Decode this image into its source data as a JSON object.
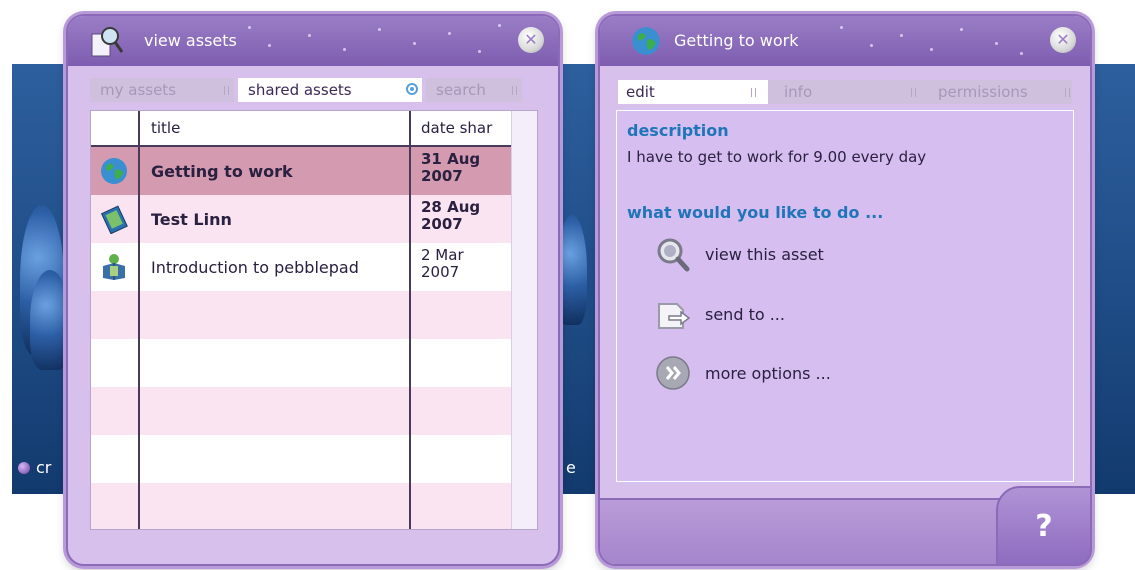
{
  "background": {
    "partial_label_left": "cr",
    "partial_label_right": "e"
  },
  "left_panel": {
    "title": "view assets",
    "close_glyph": "✕",
    "tabs": [
      {
        "label": "my assets",
        "active": false
      },
      {
        "label": "shared assets",
        "active": true
      },
      {
        "label": "search",
        "active": false
      }
    ],
    "columns": {
      "title": "title",
      "date": "date shar"
    },
    "rows": [
      {
        "icon": "globe-icon",
        "title": "Getting to work",
        "date_line1": "31 Aug",
        "date_line2": "2007",
        "bold": true,
        "selected": true
      },
      {
        "icon": "notebook-icon",
        "title": "Test Linn",
        "date_line1": "28 Aug",
        "date_line2": "2007",
        "bold": true,
        "selected": false
      },
      {
        "icon": "person-icon",
        "title": "Introduction to pebblepad",
        "date_line1": "2 Mar",
        "date_line2": "2007",
        "bold": false,
        "selected": false
      }
    ]
  },
  "right_panel": {
    "title": "Getting to work",
    "close_glyph": "✕",
    "tabs": [
      {
        "label": "edit",
        "active": true
      },
      {
        "label": "info",
        "active": false
      },
      {
        "label": "permissions",
        "active": false
      }
    ],
    "description_heading": "description",
    "description_text": "I have to get to work for 9.00 every day",
    "actions_heading": "what would you like to do ...",
    "actions": [
      {
        "icon": "magnifier-icon",
        "label": "view this asset"
      },
      {
        "icon": "send-icon",
        "label": "send to ..."
      },
      {
        "icon": "more-options-icon",
        "label": "more options ..."
      }
    ],
    "help_glyph": "?"
  },
  "colors": {
    "panel_bg": "#d8c0ec",
    "header": "#8b6bb8",
    "selected_row": "#d49ab0",
    "heading_blue": "#1f75b8"
  }
}
